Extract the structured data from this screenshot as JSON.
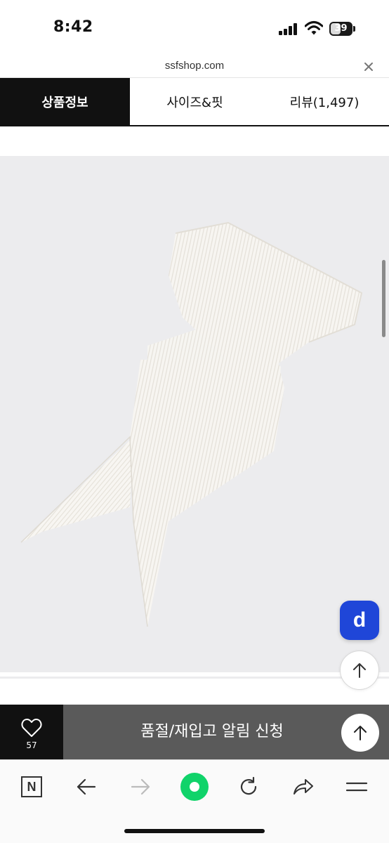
{
  "status_bar": {
    "time": "8:42",
    "battery_level": "39",
    "icons": [
      "signal-icon",
      "wifi-icon",
      "battery-icon"
    ]
  },
  "browser": {
    "url": "ssfshop.com",
    "close_icon": "close-icon"
  },
  "tabs": [
    {
      "label": "상품정보",
      "active": true
    },
    {
      "label": "사이즈&핏",
      "active": false
    },
    {
      "label": "리뷰(1,497)",
      "active": false
    }
  ],
  "floating": {
    "d_button_label": "d",
    "scroll_top_icon": "arrow-up-icon"
  },
  "action_bar": {
    "wish_count": "57",
    "restock_label": "품절/재입고 알림 신청",
    "heart_icon": "heart-icon"
  },
  "browser_toolbar": {
    "home_label": "N",
    "icons": [
      "naver-home-icon",
      "back-arrow-icon",
      "forward-arrow-icon",
      "green-dot-icon",
      "reload-icon",
      "share-icon",
      "menu-icon"
    ]
  },
  "colors": {
    "active_tab_bg": "#111111",
    "image_bg": "#ececee",
    "action_bar_bg": "#5a5a5a",
    "d_button_bg": "#1f46d8",
    "green_button": "#10d36a"
  }
}
